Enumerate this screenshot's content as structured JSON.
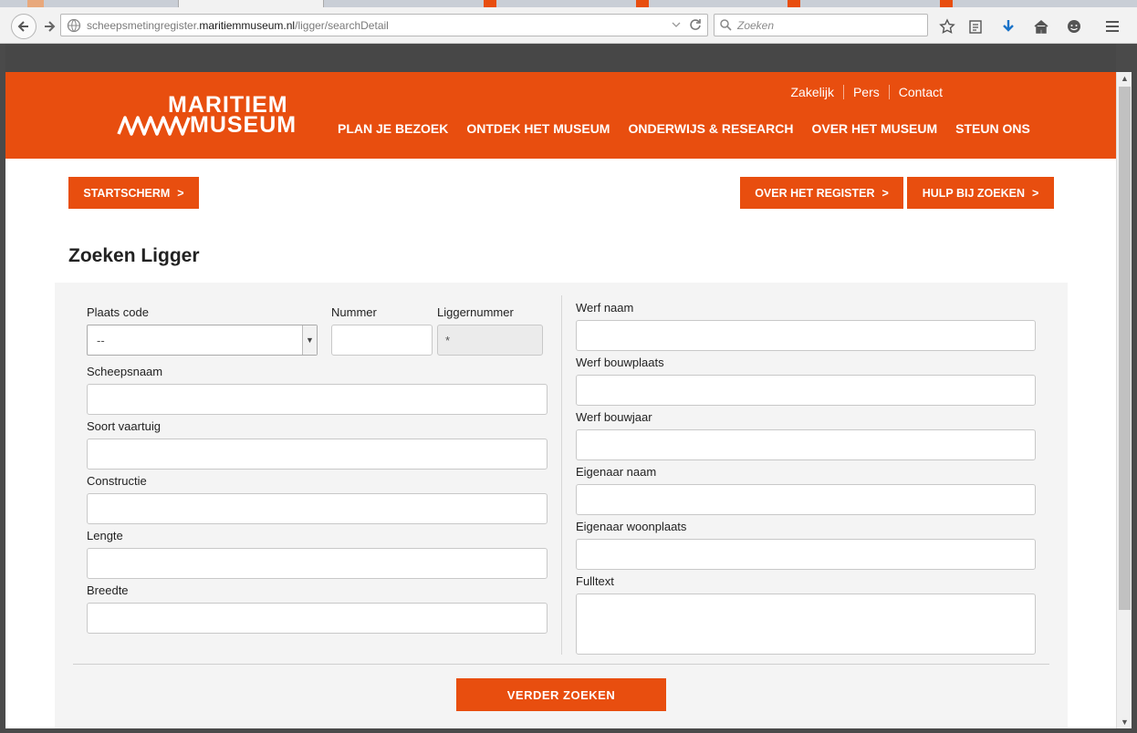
{
  "browser": {
    "url_prefix": "scheepsmetingregister.",
    "url_host": "maritiemmuseum.nl",
    "url_path": "/ligger/searchDetail",
    "search_placeholder": "Zoeken"
  },
  "site": {
    "logo_top": "MARITIEM",
    "logo_bottom": "MUSEUM",
    "util_nav": [
      "Zakelijk",
      "Pers",
      "Contact"
    ],
    "main_nav": [
      "PLAN JE BEZOEK",
      "ONTDEK HET MUSEUM",
      "ONDERWIJS & RESEARCH",
      "OVER HET MUSEUM",
      "STEUN ONS"
    ],
    "brand_color": "#e84e0f"
  },
  "actions": {
    "start": "STARTSCHERM",
    "over": "OVER HET REGISTER",
    "hulp": "HULP BIJ ZOEKEN",
    "chevron": ">"
  },
  "page_title": "Zoeken Ligger",
  "form": {
    "plaats_code_label": "Plaats code",
    "plaats_code_value": "--",
    "nummer_label": "Nummer",
    "liggernummer_label": "Liggernummer",
    "liggernummer_value": "*",
    "scheepsnaam_label": "Scheepsnaam",
    "soort_label": "Soort vaartuig",
    "constructie_label": "Constructie",
    "lengte_label": "Lengte",
    "breedte_label": "Breedte",
    "werf_naam_label": "Werf naam",
    "werf_bouwplaats_label": "Werf bouwplaats",
    "werf_bouwjaar_label": "Werf bouwjaar",
    "eigenaar_naam_label": "Eigenaar naam",
    "eigenaar_woonplaats_label": "Eigenaar woonplaats",
    "fulltext_label": "Fulltext",
    "submit": "VERDER ZOEKEN"
  }
}
